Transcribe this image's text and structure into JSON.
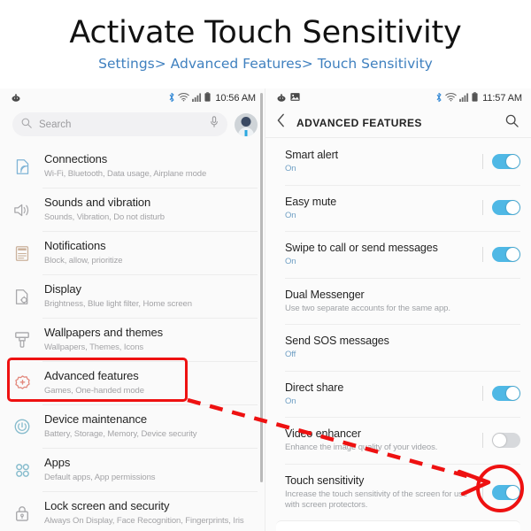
{
  "header": {
    "title": "Activate Touch Sensitivity",
    "breadcrumb": "Settings> Advanced Features> Touch Sensitivity"
  },
  "colors": {
    "accent_blue": "#3f80bf",
    "toggle_on": "#4fb8e5",
    "toggle_off": "#d7d9dc",
    "annotation_red": "#ee1111",
    "title_text": "#121212"
  },
  "left_phone": {
    "statusbar": {
      "time": "10:56 AM",
      "icons": [
        "reddit-icon",
        "bluetooth-icon",
        "wifi-icon",
        "signal-icon",
        "battery-icon"
      ]
    },
    "search": {
      "placeholder": "Search",
      "icons": [
        "search-icon",
        "mic-icon",
        "avatar"
      ]
    },
    "items": [
      {
        "title": "Connections",
        "subtitle": "Wi-Fi, Bluetooth, Data usage, Airplane mode",
        "icon": "connections-icon",
        "icon_color": "#7fb4d6",
        "highlighted": false
      },
      {
        "title": "Sounds and vibration",
        "subtitle": "Sounds, Vibration, Do not disturb",
        "icon": "sound-icon",
        "icon_color": "#a8a8ab",
        "highlighted": false
      },
      {
        "title": "Notifications",
        "subtitle": "Block, allow, prioritize",
        "icon": "notifications-icon",
        "icon_color": "#cbb29c",
        "highlighted": false
      },
      {
        "title": "Display",
        "subtitle": "Brightness, Blue light filter, Home screen",
        "icon": "display-icon",
        "icon_color": "#a8a8ab",
        "highlighted": false
      },
      {
        "title": "Wallpapers and themes",
        "subtitle": "Wallpapers, Themes, Icons",
        "icon": "wallpaper-brush-icon",
        "icon_color": "#a8a8ab",
        "highlighted": false
      },
      {
        "title": "Advanced features",
        "subtitle": "Games, One-handed mode",
        "icon": "advanced-features-icon",
        "icon_color": "#e28c80",
        "highlighted": true
      },
      {
        "title": "Device maintenance",
        "subtitle": "Battery, Storage, Memory, Device security",
        "icon": "device-maintenance-icon",
        "icon_color": "#87bccd",
        "highlighted": false
      },
      {
        "title": "Apps",
        "subtitle": "Default apps, App permissions",
        "icon": "apps-grid-icon",
        "icon_color": "#87bccd",
        "highlighted": false
      },
      {
        "title": "Lock screen and security",
        "subtitle": "Always On Display, Face Recognition, Fingerprints, Iris",
        "icon": "lock-icon",
        "icon_color": "#a8a8ab",
        "highlighted": false
      }
    ]
  },
  "right_phone": {
    "statusbar": {
      "time": "11:57 AM",
      "icons": [
        "reddit-icon",
        "image-icon",
        "bluetooth-icon",
        "wifi-icon",
        "signal-icon",
        "battery-icon"
      ]
    },
    "header": {
      "title": "ADVANCED FEATURES",
      "back_icon": "chevron-left-icon",
      "search_icon": "search-icon"
    },
    "items": [
      {
        "title": "Smart alert",
        "subtitle": "On",
        "state_style": true,
        "toggle": "on"
      },
      {
        "title": "Easy mute",
        "subtitle": "On",
        "state_style": true,
        "toggle": "on"
      },
      {
        "title": "Swipe to call or send messages",
        "subtitle": "On",
        "state_style": true,
        "toggle": "on"
      },
      {
        "title": "Dual Messenger",
        "subtitle": "Use two separate accounts for the same app.",
        "state_style": false,
        "toggle": "none"
      },
      {
        "title": "Send SOS messages",
        "subtitle": "Off",
        "state_style": true,
        "toggle": "none"
      },
      {
        "title": "Direct share",
        "subtitle": "On",
        "state_style": true,
        "toggle": "on"
      },
      {
        "title": "Video enhancer",
        "subtitle": "Enhance the image quality of your videos.",
        "state_style": false,
        "toggle": "off"
      },
      {
        "title": "Touch sensitivity",
        "subtitle": "Increase the touch sensitivity of the screen for use with screen protectors.",
        "state_style": false,
        "toggle": "on",
        "circled": true
      }
    ]
  },
  "annotations": {
    "highlight_box_target": "Advanced features",
    "arrow": "red-dashed-arrow",
    "circle_target": "Touch sensitivity toggle"
  }
}
